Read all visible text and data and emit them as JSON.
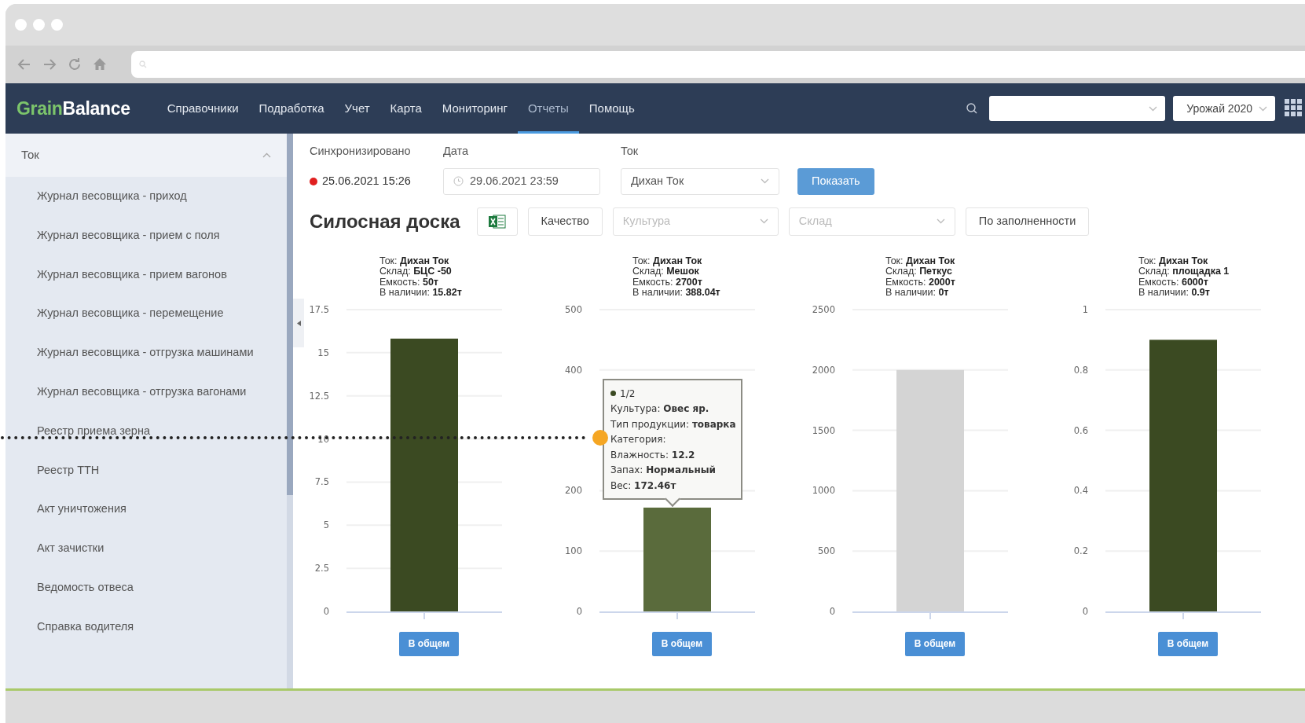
{
  "navbar": {
    "logo_accent": "Grain",
    "logo_rest": "Balance",
    "menu": [
      {
        "label": "Справочники",
        "selected": false
      },
      {
        "label": "Подработка",
        "selected": false
      },
      {
        "label": "Учет",
        "selected": false
      },
      {
        "label": "Карта",
        "selected": false
      },
      {
        "label": "Мониторинг",
        "selected": false
      },
      {
        "label": "Отчеты",
        "selected": true
      },
      {
        "label": "Помощь",
        "selected": false
      }
    ],
    "season_select": {
      "value": "Урожай 2020"
    }
  },
  "sidebar": {
    "group": {
      "label": "Ток",
      "expanded": true,
      "items": [
        {
          "label": "Журнал весовщика - приход"
        },
        {
          "label": "Журнал весовщика - прием с поля"
        },
        {
          "label": "Журнал весовщика - прием вагонов"
        },
        {
          "label": "Журнал весовщика - перемещение"
        },
        {
          "label": "Журнал весовщика - отгрузка машинами"
        },
        {
          "label": "Журнал весовщика - отгрузка вагонами"
        },
        {
          "label": "Реестр приема зерна"
        },
        {
          "label": "Реестр ТТН"
        },
        {
          "label": "Акт уничтожения"
        },
        {
          "label": "Акт зачистки"
        },
        {
          "label": "Ведомость отвеса"
        },
        {
          "label": "Справка водителя"
        }
      ]
    }
  },
  "filters": {
    "sync_label": "Синхронизировано",
    "sync_value": "25.06.2021 15:26",
    "sync_ok": false,
    "date_label": "Дата",
    "date_value": "29.06.2021 23:59",
    "tok_label": "Ток",
    "tok_value": "Дихан Ток",
    "show_button": "Показать"
  },
  "board": {
    "title": "Силосная доска",
    "quality_button": "Качество",
    "culture_placeholder": "Культура",
    "storage_placeholder": "Склад",
    "fill_button": "По заполненности"
  },
  "charts": [
    {
      "info": [
        "Ток: **Дихан Ток**",
        "Склад: **БЦС -50**",
        "Емкость: **50т**",
        "В наличии: **15.82т**"
      ],
      "chart_data": {
        "type": "bar",
        "grid": true,
        "ylim": [
          0,
          17.5
        ],
        "yticks": [
          {
            "value": 0,
            "label": "0"
          },
          {
            "value": 2.5,
            "label": "2.5"
          },
          {
            "value": 5,
            "label": "5"
          },
          {
            "value": 7.5,
            "label": "7.5"
          },
          {
            "value": 10,
            "label": "10"
          },
          {
            "value": 12.5,
            "label": "12.5"
          },
          {
            "value": 15,
            "label": "15"
          },
          {
            "value": 17.5,
            "label": "17.5"
          }
        ],
        "series": [
          {
            "color": "#3b4a22",
            "values": [
              15.82
            ]
          }
        ]
      },
      "button": "В общем"
    },
    {
      "info": [
        "Ток: **Дихан Ток**",
        "Склад: **Мешок**",
        "Емкость: **2700т**",
        "В наличии: **388.04т**"
      ],
      "chart_data": {
        "type": "bar",
        "grid": true,
        "ylim": [
          0,
          500
        ],
        "yticks": [
          {
            "value": 0,
            "label": "0"
          },
          {
            "value": 100,
            "label": "100"
          },
          {
            "value": 200,
            "label": "200"
          },
          {
            "value": 400,
            "label": "400"
          },
          {
            "value": 500,
            "label": "500"
          }
        ],
        "series": [
          {
            "color": "#5a6b3c",
            "values": [
              172
            ]
          }
        ]
      },
      "button": "В общем",
      "tooltip": {
        "counter": "1/2",
        "lines": [
          "Культура: **Овес яр.**",
          "Тип продукции: **товарка**",
          "Категория:",
          "Влажность: **12.2**",
          "Запах: **Нормальный**",
          "Вес: **172.46т**"
        ]
      }
    },
    {
      "info": [
        "Ток: **Дихан Ток**",
        "Склад: **Петкус**",
        "Емкость: **2000т**",
        "В наличии: **0т**"
      ],
      "chart_data": {
        "type": "bar",
        "grid": true,
        "ylim": [
          0,
          2500
        ],
        "yticks": [
          {
            "value": 0,
            "label": "0"
          },
          {
            "value": 500,
            "label": "500"
          },
          {
            "value": 1000,
            "label": "1000"
          },
          {
            "value": 1500,
            "label": "1500"
          },
          {
            "value": 2000,
            "label": "2000"
          },
          {
            "value": 2500,
            "label": "2500"
          }
        ],
        "series": [
          {
            "color": "#d4d4d4",
            "values": [
              2000
            ]
          }
        ]
      },
      "button": "В общем"
    },
    {
      "info": [
        "Ток: **Дихан Ток**",
        "Склад: **площадка 1**",
        "Емкость: **6000т**",
        "В наличии: **0.9т**"
      ],
      "chart_data": {
        "type": "bar",
        "grid": true,
        "ylim": [
          0,
          1
        ],
        "yticks": [
          {
            "value": 0,
            "label": "0"
          },
          {
            "value": 0.2,
            "label": "0.2"
          },
          {
            "value": 0.4,
            "label": "0.4"
          },
          {
            "value": 0.6,
            "label": "0.6"
          },
          {
            "value": 0.8,
            "label": "0.8"
          },
          {
            "value": 1,
            "label": "1"
          }
        ],
        "series": [
          {
            "color": "#3b4a22",
            "values": [
              0.9
            ]
          }
        ]
      },
      "button": "В общем"
    }
  ]
}
